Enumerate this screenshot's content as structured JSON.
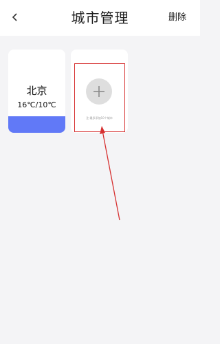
{
  "header": {
    "title": "城市管理",
    "delete_label": "删除",
    "back_icon": "chevron-left-icon"
  },
  "cities": [
    {
      "name": "北京",
      "temp": "16℃/10℃",
      "bar_color": "#6179f7"
    }
  ],
  "add_card": {
    "icon": "plus-icon",
    "hint": "注:最多添加10个城市",
    "highlight_color": "#d63030"
  },
  "colors": {
    "background": "#f4f4f6",
    "card": "#ffffff",
    "accent": "#6179f7",
    "annotation": "#d63030"
  }
}
